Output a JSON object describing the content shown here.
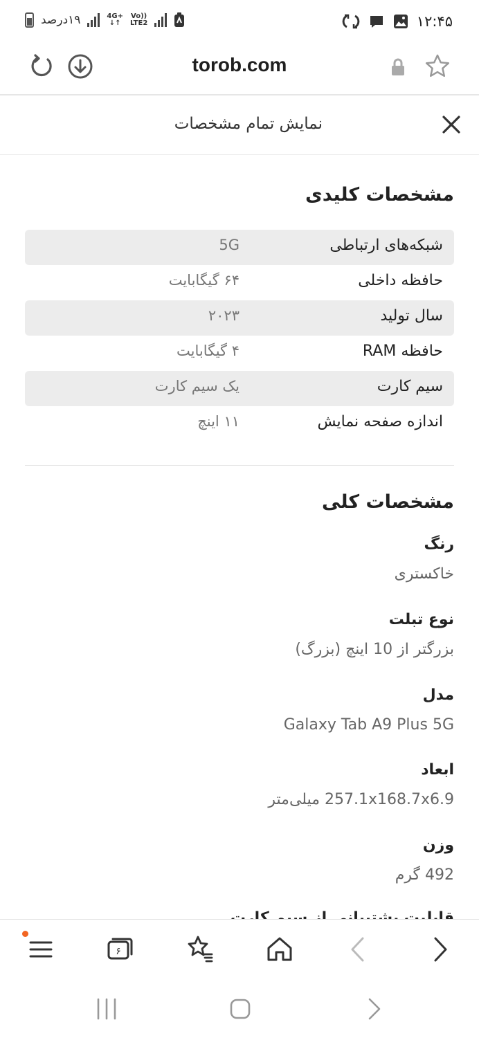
{
  "status_bar": {
    "time": "۱۲:۴۵",
    "battery_text": "۱۹درصد",
    "network_label_top": "4G+",
    "network_label_bottom": "LTE2",
    "volte_label": "Vo))"
  },
  "browser": {
    "url": "torob.com",
    "icons": [
      "star-icon",
      "lock-icon",
      "download-icon",
      "refresh-icon"
    ]
  },
  "panel": {
    "title": "نمایش تمام مشخصات",
    "close_icon": "close-icon"
  },
  "key_specs": {
    "title": "مشخصات کلیدی",
    "rows": [
      {
        "label": "شبکه‌های ارتباطی",
        "value": "5G"
      },
      {
        "label": "حافظه داخلی",
        "value": "۶۴ گیگابایت"
      },
      {
        "label": "سال تولید",
        "value": "۲۰۲۳"
      },
      {
        "label": "حافظه RAM",
        "value": "۴ گیگابایت"
      },
      {
        "label": "سیم کارت",
        "value": "یک سیم کارت"
      },
      {
        "label": "اندازه صفحه نمایش",
        "value": "۱۱ اینچ"
      }
    ]
  },
  "general_specs": {
    "title": "مشخصات کلی",
    "items": [
      {
        "label": "رنگ",
        "value": "خاکستری"
      },
      {
        "label": "نوع تبلت",
        "value": "بزرگتر از 10 اینچ (بزرگ)"
      },
      {
        "label": "مدل",
        "value": "Galaxy Tab A9 Plus 5G"
      },
      {
        "label": "ابعاد",
        "value": "257.1x168.7x6.9 میلی‌متر"
      },
      {
        "label": "وزن",
        "value": "492 گرم"
      },
      {
        "label": "قابلیت پشتیبانی از سیم کارت",
        "value": ""
      }
    ]
  },
  "bottom_bar": {
    "tabs_count": "۶",
    "badge_color": "#f26522"
  },
  "colors": {
    "row_shade": "#ececec",
    "text_primary": "#222222",
    "text_secondary": "#777777"
  }
}
